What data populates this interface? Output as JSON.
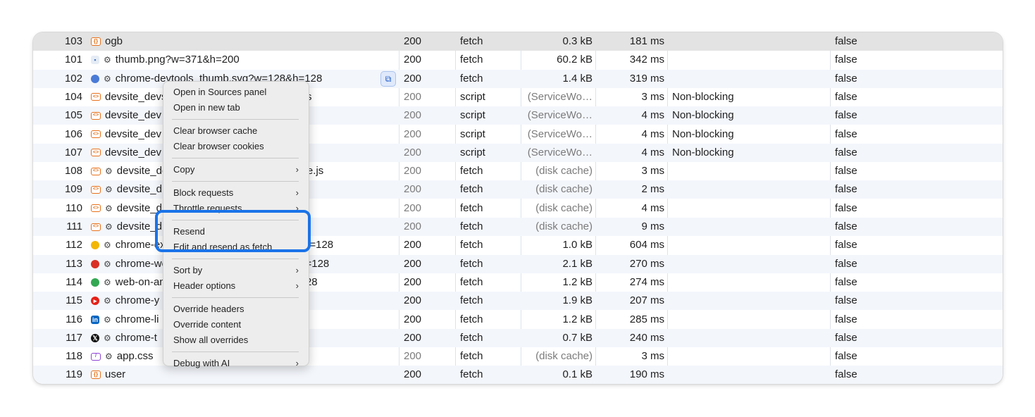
{
  "rows": [
    {
      "num": "103",
      "icon": "json",
      "gear": false,
      "name": "ogb",
      "status": "200",
      "type": "fetch",
      "size": "0.3 kB",
      "time": "181 ms",
      "priority": "",
      "flag": "false"
    },
    {
      "num": "101",
      "icon": "img",
      "gear": true,
      "name": "thumb.png?w=371&h=200",
      "status": "200",
      "type": "fetch",
      "size": "60.2 kB",
      "time": "342 ms",
      "priority": "",
      "flag": "false"
    },
    {
      "num": "102",
      "icon": "svg",
      "gear": true,
      "name": "chrome-devtools_thumb.svg?w=128&h=128",
      "status": "200",
      "type": "fetch",
      "size": "1.4 kB",
      "time": "319 ms",
      "priority": "",
      "flag": "false"
    },
    {
      "num": "104",
      "icon": "js",
      "gear": false,
      "name": "devsite_devsite_webcomponents_module.js",
      "status": "200",
      "type": "script",
      "size": "(ServiceWo…",
      "time": "3 ms",
      "priority": "Non-blocking",
      "flag": "false"
    },
    {
      "num": "105",
      "icon": "js",
      "gear": false,
      "name": "devsite_dev",
      "status": "200",
      "type": "script",
      "size": "(ServiceWo…",
      "time": "4 ms",
      "priority": "Non-blocking",
      "flag": "false"
    },
    {
      "num": "106",
      "icon": "js",
      "gear": false,
      "name": "devsite_dev",
      "status": "200",
      "type": "script",
      "size": "(ServiceWo…",
      "time": "4 ms",
      "priority": "Non-blocking",
      "flag": "false"
    },
    {
      "num": "107",
      "icon": "js",
      "gear": false,
      "name": "devsite_dev",
      "status": "200",
      "type": "script",
      "size": "(ServiceWo…",
      "time": "4 ms",
      "priority": "Non-blocking",
      "flag": "false"
    },
    {
      "num": "108",
      "icon": "js",
      "gear": true,
      "name": "devsite_devsite_webcomponents_module.js",
      "status": "200",
      "type": "fetch",
      "size": "(disk cache)",
      "time": "3 ms",
      "priority": "",
      "flag": "false"
    },
    {
      "num": "109",
      "icon": "js",
      "gear": true,
      "name": "devsite_d",
      "status": "200",
      "type": "fetch",
      "size": "(disk cache)",
      "time": "2 ms",
      "priority": "",
      "flag": "false"
    },
    {
      "num": "110",
      "icon": "js",
      "gear": true,
      "name": "devsite_d",
      "status": "200",
      "type": "fetch",
      "size": "(disk cache)",
      "time": "4 ms",
      "priority": "",
      "flag": "false"
    },
    {
      "num": "111",
      "icon": "js",
      "gear": true,
      "name": "devsite_d",
      "status": "200",
      "type": "fetch",
      "size": "(disk cache)",
      "time": "9 ms",
      "priority": "",
      "flag": "false"
    },
    {
      "num": "112",
      "icon": "yellow",
      "gear": true,
      "name": "chrome-extensions_thumb.svg?w=128&h=128",
      "status": "200",
      "type": "fetch",
      "size": "1.0 kB",
      "time": "604 ms",
      "priority": "",
      "flag": "false"
    },
    {
      "num": "113",
      "icon": "red",
      "gear": true,
      "name": "chrome-web-store_thumb.svg?w=128&h=128",
      "status": "200",
      "type": "fetch",
      "size": "2.1 kB",
      "time": "270 ms",
      "priority": "",
      "flag": "false"
    },
    {
      "num": "114",
      "icon": "green",
      "gear": true,
      "name": "web-on-android_thumb.svg?w=128&h=128",
      "status": "200",
      "type": "fetch",
      "size": "1.2 kB",
      "time": "274 ms",
      "priority": "",
      "flag": "false"
    },
    {
      "num": "115",
      "icon": "yt",
      "gear": true,
      "name": "chrome-y",
      "status": "200",
      "type": "fetch",
      "size": "1.9 kB",
      "time": "207 ms",
      "priority": "",
      "flag": "false"
    },
    {
      "num": "116",
      "icon": "li",
      "gear": true,
      "name": "chrome-li",
      "status": "200",
      "type": "fetch",
      "size": "1.2 kB",
      "time": "285 ms",
      "priority": "",
      "flag": "false"
    },
    {
      "num": "117",
      "icon": "x",
      "gear": true,
      "name": "chrome-t",
      "status": "200",
      "type": "fetch",
      "size": "0.7 kB",
      "time": "240 ms",
      "priority": "",
      "flag": "false"
    },
    {
      "num": "118",
      "icon": "css",
      "gear": true,
      "name": "app.css",
      "status": "200",
      "type": "fetch",
      "size": "(disk cache)",
      "time": "3 ms",
      "priority": "",
      "flag": "false"
    },
    {
      "num": "119",
      "icon": "json",
      "gear": false,
      "name": "user",
      "status": "200",
      "type": "fetch",
      "size": "0.1 kB",
      "time": "190 ms",
      "priority": "",
      "flag": "false"
    }
  ],
  "icon_names": {
    "json": "json-file-icon",
    "img": "image-file-icon",
    "svg": "svg-file-icon",
    "js": "script-file-icon",
    "yellow": "extension-icon",
    "red": "web-store-icon",
    "green": "android-icon",
    "yt": "youtube-icon",
    "li": "linkedin-icon",
    "x": "x-twitter-icon",
    "css": "stylesheet-file-icon"
  },
  "icon_glyphs": {
    "json": "{}",
    "img": "▪",
    "svg": "",
    "js": "<>",
    "yellow": "",
    "red": "",
    "green": "",
    "yt": "▸",
    "li": "in",
    "x": "𝕏",
    "css": "/"
  },
  "gear_glyph": "⚙",
  "ai_button_glyph": "⧉",
  "context_menu": {
    "groups": [
      [
        {
          "label": "Open in Sources panel",
          "submenu": false
        },
        {
          "label": "Open in new tab",
          "submenu": false
        }
      ],
      [
        {
          "label": "Clear browser cache",
          "submenu": false
        },
        {
          "label": "Clear browser cookies",
          "submenu": false
        }
      ],
      [
        {
          "label": "Copy",
          "submenu": true
        }
      ],
      [
        {
          "label": "Block requests",
          "submenu": true
        },
        {
          "label": "Throttle requests",
          "submenu": true
        }
      ],
      [
        {
          "label": "Resend",
          "submenu": false
        },
        {
          "label": "Edit and resend as fetch",
          "submenu": false
        }
      ],
      [
        {
          "label": "Sort by",
          "submenu": true
        },
        {
          "label": "Header options",
          "submenu": true
        }
      ],
      [
        {
          "label": "Override headers",
          "submenu": false
        },
        {
          "label": "Override content",
          "submenu": false
        },
        {
          "label": "Show all overrides",
          "submenu": false
        }
      ],
      [
        {
          "label": "Debug with AI",
          "submenu": true
        }
      ]
    ],
    "chevron_glyph": "›"
  },
  "colors": {
    "accent": "#1a73e8",
    "selected_row": "#e3e3e3",
    "alt_row": "#f3f6fb"
  }
}
